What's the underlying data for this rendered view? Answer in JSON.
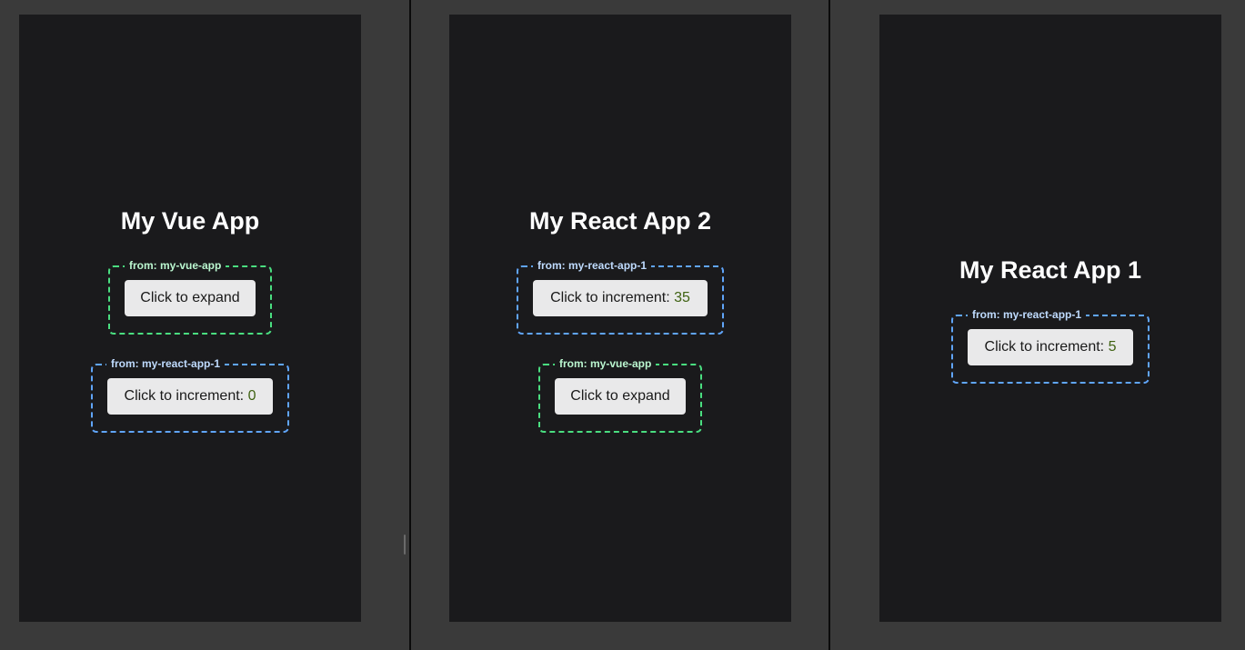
{
  "panes": [
    {
      "title": "My Vue App",
      "remotes": [
        {
          "source": "from: my-vue-app",
          "button_label": "Click to expand"
        },
        {
          "source": "from: my-react-app-1",
          "button_label": "Click to increment: ",
          "count": "0"
        }
      ]
    },
    {
      "title": "My React App 2",
      "remotes": [
        {
          "source": "from: my-react-app-1",
          "button_label": "Click to increment: ",
          "count": "35"
        },
        {
          "source": "from: my-vue-app",
          "button_label": "Click to expand"
        }
      ]
    },
    {
      "title": "My React App 1",
      "remotes": [
        {
          "source": "from: my-react-app-1",
          "button_label": "Click to increment: ",
          "count": "5"
        }
      ]
    }
  ],
  "colors": {
    "vue_border": "#4ade80",
    "react_border": "#60a5fa",
    "app_background": "#1a1a1c",
    "page_background": "#3a3a3a"
  }
}
